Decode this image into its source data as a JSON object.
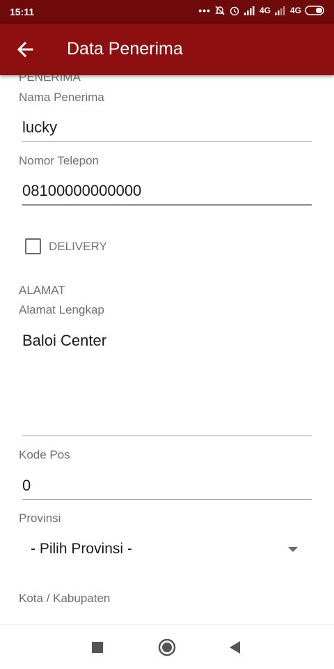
{
  "status_bar": {
    "time": "15:11",
    "indicators": "... 4G 4G",
    "icons": [
      "notifications-off-icon",
      "alarm-icon",
      "signal-icon",
      "signal-icon",
      "battery-icon"
    ]
  },
  "app_bar": {
    "title": "Data Penerima",
    "back_icon": "arrow-left-icon",
    "color": "#8e0f0f"
  },
  "form": {
    "section_penerima": "PENERIMA",
    "nama_label": "Nama Penerima",
    "nama_value": "lucky",
    "telepon_label": "Nomor Telepon",
    "telepon_value": "08100000000000",
    "delivery_label": "DELIVERY",
    "delivery_checked": false,
    "section_alamat": "ALAMAT",
    "alamat_label": "Alamat Lengkap",
    "alamat_value": "Baloi Center",
    "kodepos_label": "Kode Pos",
    "kodepos_value": "0",
    "provinsi_label": "Provinsi",
    "provinsi_value": "- Pilih Provinsi -",
    "kota_label": "Kota / Kabupaten"
  },
  "nav_bar": {
    "icons": [
      "recent-apps-icon",
      "home-icon",
      "back-icon"
    ]
  }
}
